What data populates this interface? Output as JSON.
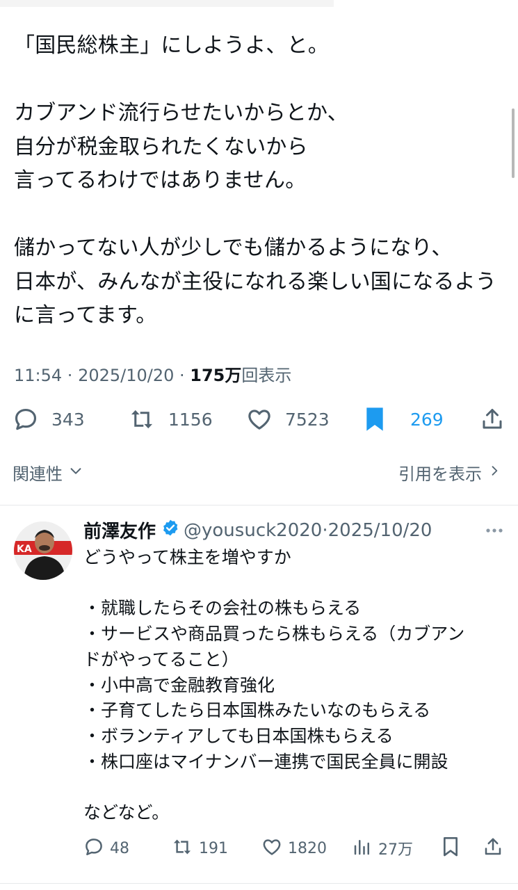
{
  "main_tweet": {
    "lines": [
      "「国民総株主」にしようよ、と。",
      "",
      "カブアンド流行らせたいからとか、",
      "自分が税金取られたくないから",
      "言ってるわけではありません。",
      "",
      "儲かってない人が少しでも儲かるようになり、",
      "日本が、みんなが主役になれる楽しい国になるよう",
      "に言ってます。"
    ],
    "time": "11:54",
    "date": "2025/10/20",
    "views_count": "175万",
    "views_label": "回表示",
    "stats": {
      "replies": "343",
      "reposts": "1156",
      "likes": "7523",
      "bookmarks": "269"
    },
    "related_label": "関連性",
    "quotes_label": "引用を表示"
  },
  "reply": {
    "name": "前澤友作",
    "handle": "@yousuck2020",
    "date": "2025/10/20",
    "avatar_text": "KA",
    "lines": [
      "どうやって株主を増やすか",
      "",
      "・就職したらその会社の株もらえる",
      "・サービスや商品買ったら株もらえる（カブアン",
      "ドがやってること）",
      "・小中高で金融教育強化",
      "・子育てしたら日本国株みたいなのもらえる",
      "・ボランティアしても日本国株もらえる",
      "・株口座はマイナンバー連携で国民全員に開設",
      "",
      "などなど。"
    ],
    "stats": {
      "replies": "48",
      "reposts": "191",
      "likes": "1820",
      "views": "27万"
    }
  },
  "icons": {
    "reply": "reply-icon",
    "repost": "repost-icon",
    "like": "like-icon",
    "bookmark": "bookmark-icon",
    "share": "share-icon",
    "views": "views-icon",
    "verified": "verified-icon",
    "more": "more-icon"
  },
  "colors": {
    "accent": "#1d9bf0",
    "text": "#0f1419",
    "muted": "#536471"
  }
}
